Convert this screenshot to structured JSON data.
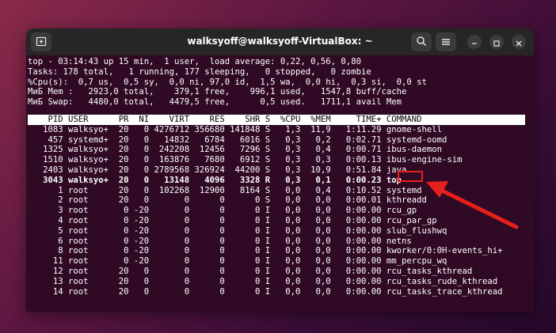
{
  "window": {
    "title": "walksyoff@walksyoff-VirtualBox: ~"
  },
  "summary": [
    "top - 03:14:43 up 15 min,  1 user,  load average: 0,22, 0,56, 0,80",
    "Tasks: 178 total,   1 running, 177 sleeping,   0 stopped,   0 zombie",
    "%Cpu(s):  0,7 us,  0,5 sy,  0,0 ni, 97,0 id,  1,5 wa,  0,0 hi,  0,3 si,  0,0 st",
    "МиБ Mem :   2923,0 total,    379,1 free,    996,1 used,   1547,8 buff/cache",
    "МиБ Swap:   4480,0 total,   4479,5 free,      0,5 used.   1711,1 avail Mem"
  ],
  "table_header": "    PID USER      PR  NI    VIRT    RES    SHR S  %CPU  %MEM     TIME+ COMMAND",
  "processes": [
    "   1083 walksyo+  20   0 4276712 356680 141848 S   1,3  11,9   1:11.29 gnome-shell",
    "    457 systemd+  20   0   14832   6784   6016 S   0,3   0,2   0:02.71 systemd-oomd",
    "   1325 walksyo+  20   0  242208  12456   7296 S   0,3   0,4   0:00.71 ibus-daemon",
    "   1510 walksyo+  20   0  163876   7680   6912 S   0,3   0,3   0:00.13 ibus-engine-sim",
    "   2403 walksyo+  20   0 2789568 326924  44200 S   0,3  10,9   0:51.84 java",
    "   3043 walksyo+  20   0   13148   4096   3328 R   0,3   0,1   0:00.23 top",
    "      1 root      20   0  102268  12900   8164 S   0,0   0,4   0:10.52 systemd",
    "      2 root      20   0       0      0      0 S   0,0   0,0   0:00.01 kthreadd",
    "      3 root       0 -20       0      0      0 I   0,0   0,0   0:00.00 rcu_gp",
    "      4 root       0 -20       0      0      0 I   0,0   0,0   0:00.00 rcu_par_gp",
    "      5 root       0 -20       0      0      0 I   0,0   0,0   0:00.00 slub_flushwq",
    "      6 root       0 -20       0      0      0 I   0,0   0,0   0:00.00 netns",
    "      8 root       0 -20       0      0      0 I   0,0   0,0   0:00.00 kworker/0:0H-events_hi+",
    "     11 root       0 -20       0      0      0 I   0,0   0,0   0:00.00 mm_percpu_wq",
    "     12 root      20   0       0      0      0 I   0,0   0,0   0:00.00 rcu_tasks_kthread",
    "     13 root      20   0       0      0      0 I   0,0   0,0   0:00.00 rcu_tasks_rude_kthread",
    "     14 root      20   0       0      0      0 I   0,0   0,0   0:00.00 rcu_tasks_trace_kthread"
  ],
  "icons": {
    "new_tab": "new-tab-icon",
    "search": "search-icon",
    "menu": "hamburger-menu-icon",
    "minimize": "minimize-icon",
    "maximize": "maximize-icon",
    "close": "close-icon"
  },
  "colors": {
    "terminal_bg": "#300a24",
    "titlebar_bg": "#262626",
    "highlight": "#e8201c"
  }
}
